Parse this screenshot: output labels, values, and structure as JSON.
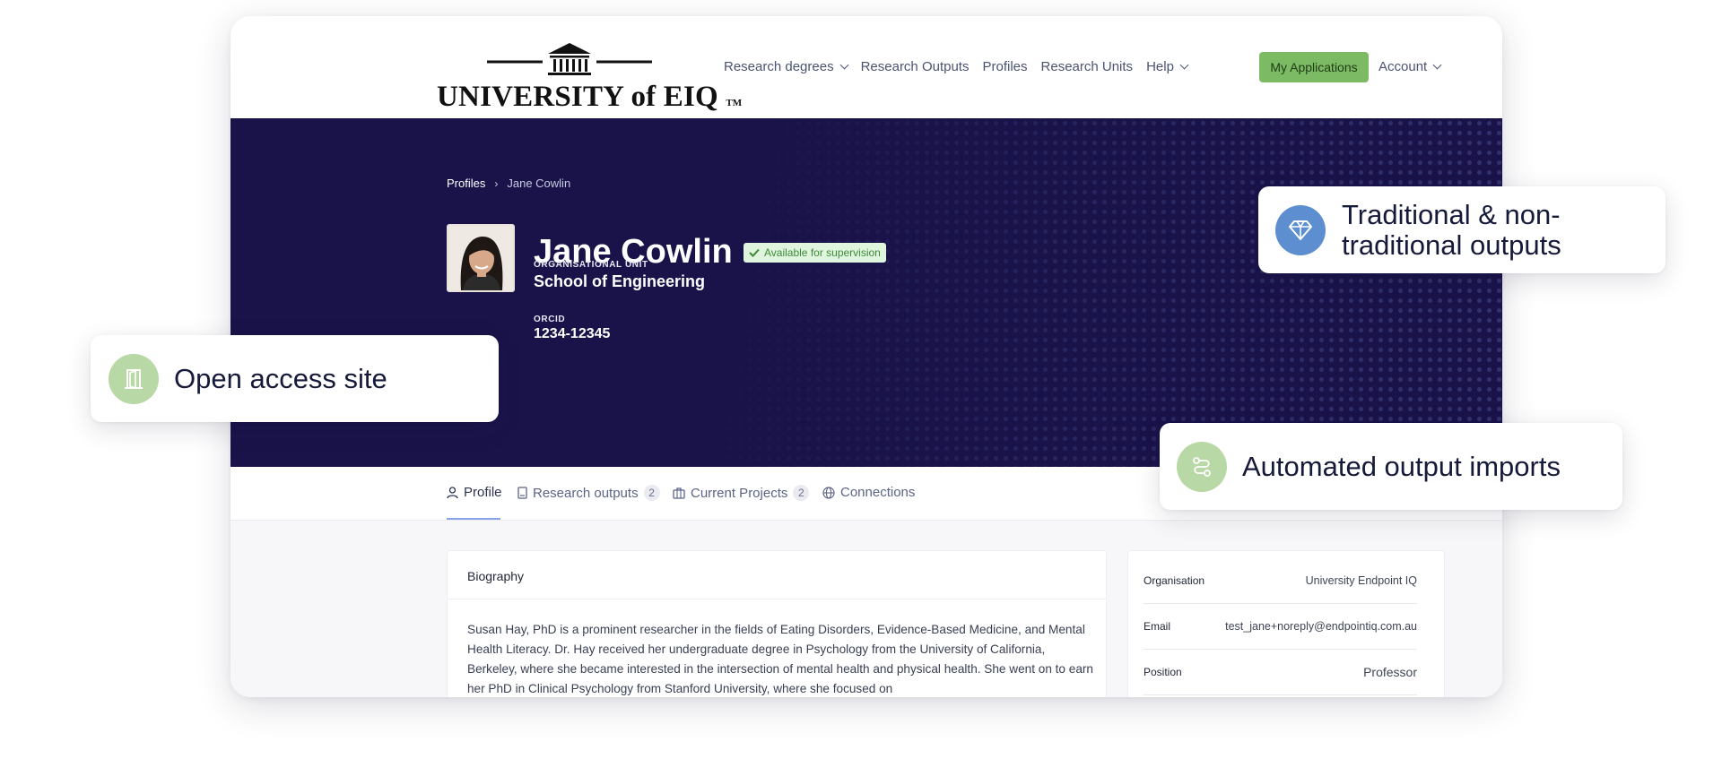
{
  "header": {
    "logo_text": "UNIVERSITY of EIQ",
    "logo_tm": "TM",
    "nav": [
      {
        "label": "Research degrees",
        "dropdown": true
      },
      {
        "label": "Research Outputs",
        "dropdown": false
      },
      {
        "label": "Profiles",
        "dropdown": false
      },
      {
        "label": "Research Units",
        "dropdown": false
      },
      {
        "label": "Help",
        "dropdown": true
      }
    ],
    "applications_button": "My Applications",
    "account_label": "Account"
  },
  "hero": {
    "breadcrumb": [
      "Profiles",
      "Jane Cowlin"
    ],
    "name": "Jane Cowlin",
    "badge": "Available for supervision",
    "org_unit_label": "ORGANISATIONAL UNIT",
    "org_unit_value": "School of Engineering",
    "orcid_label": "ORCID",
    "orcid_value": "1234-12345"
  },
  "tabs": [
    {
      "label": "Profile",
      "icon": "person-icon",
      "count": null
    },
    {
      "label": "Research outputs",
      "icon": "document-icon",
      "count": "2"
    },
    {
      "label": "Current Projects",
      "icon": "briefcase-icon",
      "count": "2"
    },
    {
      "label": "Connections",
      "icon": "globe-icon",
      "count": null
    }
  ],
  "biography": {
    "title": "Biography",
    "text": "Susan Hay, PhD is a prominent researcher in the fields of Eating Disorders, Evidence-Based Medicine, and Mental Health Literacy. Dr. Hay received her undergraduate degree in Psychology from the University of California, Berkeley, where she became interested in the intersection of mental health and physical health. She went on to earn her PhD in Clinical Psychology from Stanford University, where she focused on"
  },
  "info": [
    {
      "key": "Organisation",
      "value": "University Endpoint IQ"
    },
    {
      "key": "Email",
      "value": "test_jane+noreply@endpointiq.com.au"
    },
    {
      "key": "Position",
      "value": "Professor"
    }
  ],
  "callouts": {
    "outputs": "Traditional & non-traditional outputs",
    "open_access": "Open access site",
    "imports": "Automated output imports"
  },
  "colors": {
    "hero_bg": "#19134a",
    "accent_green": "#7cba63",
    "callout_green": "#b8d8a5",
    "callout_blue": "#5d8fd0"
  }
}
